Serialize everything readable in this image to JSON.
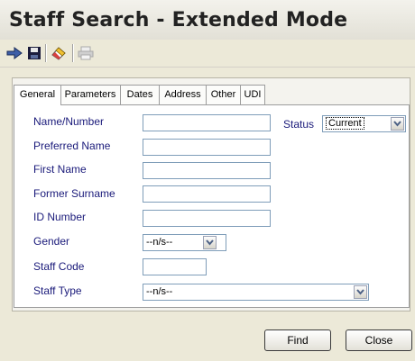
{
  "window": {
    "title": "Staff Search - Extended Mode"
  },
  "toolbar": {
    "items": [
      {
        "icon": "pointer-hand-icon"
      },
      {
        "icon": "save-disk-icon"
      },
      {
        "icon": "eraser-icon"
      },
      {
        "icon": "printer-icon",
        "disabled": true
      }
    ]
  },
  "tabs": [
    "General",
    "Parameters",
    "Dates",
    "Address",
    "Other",
    "UDI"
  ],
  "active_tab": "General",
  "form": {
    "name_number": {
      "label": "Name/Number",
      "value": ""
    },
    "status": {
      "label": "Status",
      "value": "Current"
    },
    "preferred_name": {
      "label": "Preferred Name",
      "value": ""
    },
    "first_name": {
      "label": "First Name",
      "value": ""
    },
    "former_surname": {
      "label": "Former Surname",
      "value": ""
    },
    "id_number": {
      "label": "ID Number",
      "value": ""
    },
    "gender": {
      "label": "Gender",
      "value": "--n/s--"
    },
    "staff_code": {
      "label": "Staff Code",
      "value": ""
    },
    "staff_type": {
      "label": "Staff Type",
      "value": "--n/s--"
    }
  },
  "buttons": {
    "find": "Find",
    "close": "Close"
  },
  "colors": {
    "label_text": "#1a1a7a",
    "field_border": "#7f9db9",
    "window_bg": "#ece9d8"
  }
}
